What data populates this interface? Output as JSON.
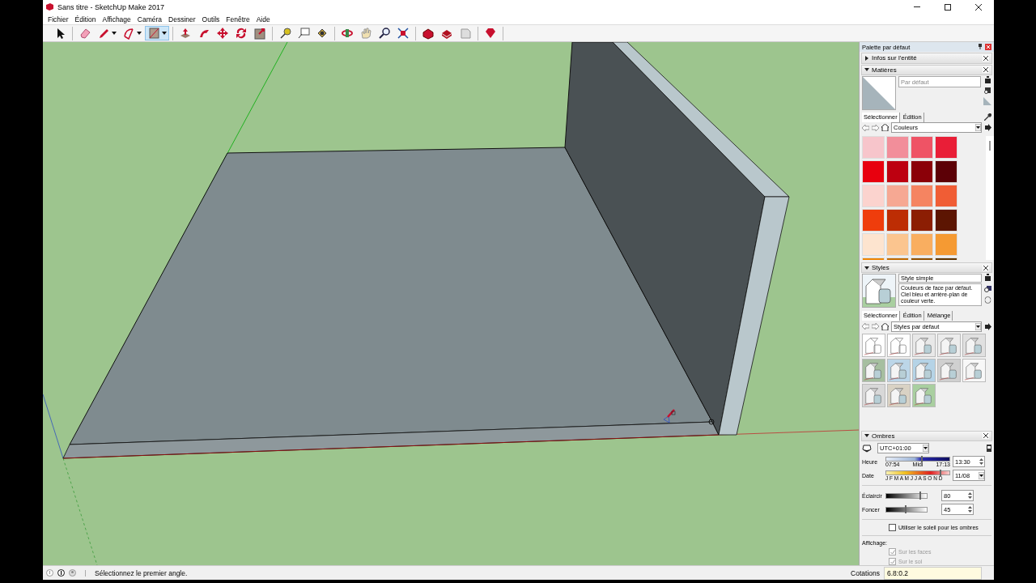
{
  "window": {
    "title": "Sans titre - SketchUp Make 2017"
  },
  "menu": [
    "Fichier",
    "Édition",
    "Affichage",
    "Caméra",
    "Dessiner",
    "Outils",
    "Fenêtre",
    "Aide"
  ],
  "toolbar": {
    "groups": [
      [
        {
          "kind": "select",
          "selected": false,
          "dropdown": false
        }
      ],
      [
        {
          "kind": "eraser",
          "selected": false,
          "dropdown": false
        },
        {
          "kind": "pencil",
          "selected": false,
          "dropdown": true
        },
        {
          "kind": "arc",
          "selected": false,
          "dropdown": true
        },
        {
          "kind": "rectangle",
          "selected": true,
          "dropdown": true
        }
      ],
      [
        {
          "kind": "pushpull",
          "selected": false,
          "dropdown": false
        },
        {
          "kind": "followme",
          "selected": false,
          "dropdown": false
        },
        {
          "kind": "move",
          "selected": false,
          "dropdown": false
        },
        {
          "kind": "rotate",
          "selected": false,
          "dropdown": false
        },
        {
          "kind": "scale",
          "selected": false,
          "dropdown": false
        }
      ],
      [
        {
          "kind": "tape",
          "selected": false,
          "dropdown": false
        },
        {
          "kind": "text",
          "selected": false,
          "dropdown": false
        },
        {
          "kind": "paint",
          "selected": false,
          "dropdown": false
        }
      ],
      [
        {
          "kind": "orbit",
          "selected": false,
          "dropdown": false
        },
        {
          "kind": "pan",
          "selected": false,
          "dropdown": false
        },
        {
          "kind": "zoom",
          "selected": false,
          "dropdown": false
        },
        {
          "kind": "extents",
          "selected": false,
          "dropdown": false
        }
      ],
      [
        {
          "kind": "warehouse",
          "selected": false,
          "dropdown": false
        },
        {
          "kind": "extension",
          "selected": false,
          "dropdown": false
        },
        {
          "kind": "layout",
          "selected": false,
          "dropdown": false
        }
      ],
      [
        {
          "kind": "ruby",
          "selected": false,
          "dropdown": false
        }
      ]
    ]
  },
  "tray": {
    "title": "Palette par défaut",
    "entity_info": {
      "title": "Infos sur l'entité",
      "expanded": false
    },
    "materials": {
      "title": "Matières",
      "expanded": true,
      "placeholder": "Par défaut",
      "tabs": [
        {
          "label": "Sélectionner",
          "selected": true
        },
        {
          "label": "Édition",
          "selected": false
        }
      ],
      "library": "Couleurs",
      "swatches": [
        {
          "color": "#f7c5cb"
        },
        {
          "color": "#f28e9a"
        },
        {
          "color": "#ef5365"
        },
        {
          "color": "#e91e37"
        },
        {
          "color": "#e8000e"
        },
        {
          "color": "#bd0010"
        },
        {
          "color": "#8b0008"
        },
        {
          "color": "#5c0006"
        },
        {
          "color": "#fbd3ce"
        },
        {
          "color": "#f6a893"
        },
        {
          "color": "#f58461"
        },
        {
          "color": "#f05d35"
        },
        {
          "color": "#ef3d0c"
        },
        {
          "color": "#bd2d04"
        },
        {
          "color": "#8c1e03"
        },
        {
          "color": "#5c1502"
        },
        {
          "color": "#fde4cf"
        },
        {
          "color": "#fbc58f"
        },
        {
          "color": "#f9ae60"
        },
        {
          "color": "#f59a33"
        },
        {
          "color": "#ee8400"
        },
        {
          "color": "#c06a00"
        },
        {
          "color": "#8f4f00"
        },
        {
          "color": "#5e3400"
        }
      ]
    },
    "styles": {
      "title": "Styles",
      "expanded": true,
      "name": "Style simple",
      "description": "Couleurs de face par défaut. Ciel bleu et arrière-plan de couleur verte.",
      "tabs": [
        {
          "label": "Sélectionner",
          "selected": true
        },
        {
          "label": "Édition",
          "selected": false
        },
        {
          "label": "Mélange",
          "selected": false
        }
      ],
      "library": "Styles par défaut",
      "thumbnails": [
        {
          "kind": "outline",
          "color": "#ffffff"
        },
        {
          "kind": "outline",
          "color": "#fefefe"
        },
        {
          "kind": "shaded",
          "color": "#e8e8e8"
        },
        {
          "kind": "shaded",
          "color": "#ececec"
        },
        {
          "kind": "shaded",
          "color": "#e0e0e0"
        },
        {
          "kind": "shaded",
          "color": "#a6bfa0"
        },
        {
          "kind": "shaded",
          "color": "#bcd6e8"
        },
        {
          "kind": "shaded",
          "color": "#b5d3e6"
        },
        {
          "kind": "shaded",
          "color": "#d0d0d0"
        },
        {
          "kind": "shaded",
          "color": "#f8f8f8"
        },
        {
          "kind": "shaded",
          "color": "#d8d8d8"
        },
        {
          "kind": "shaded",
          "color": "#d9d2c4"
        },
        {
          "kind": "shaded",
          "color": "#a9cfa0"
        }
      ]
    },
    "shadows": {
      "title": "Ombres",
      "expanded": true,
      "timezone": "UTC+01:00",
      "time_label": "Heure",
      "time_slider": {
        "level": 0.55
      },
      "time_ticks": [
        "07:54",
        "Midi",
        "17:13"
      ],
      "time": "13:30",
      "date_label": "Date",
      "date_slider": {
        "level": 0.85
      },
      "months": "J F M A M J J A S O N D",
      "date": "11/08",
      "sliders": [
        {
          "label": "Éclaircir",
          "level": 0.82,
          "value": "80"
        },
        {
          "label": "Foncer",
          "level": 0.45,
          "value": "45"
        }
      ],
      "use_sun": {
        "label": "Utiliser le soleil pour les ombres",
        "checked": false
      },
      "display_label": "Affichage:",
      "display": [
        {
          "label": "Sur les faces",
          "checked": true,
          "disabled": true
        },
        {
          "label": "Sur le sol",
          "checked": true,
          "disabled": true
        }
      ]
    }
  },
  "status_bar": {
    "message": "Sélectionnez le premier angle.",
    "measurements_label": "Cotations",
    "measurements": "6.8:0.2"
  }
}
